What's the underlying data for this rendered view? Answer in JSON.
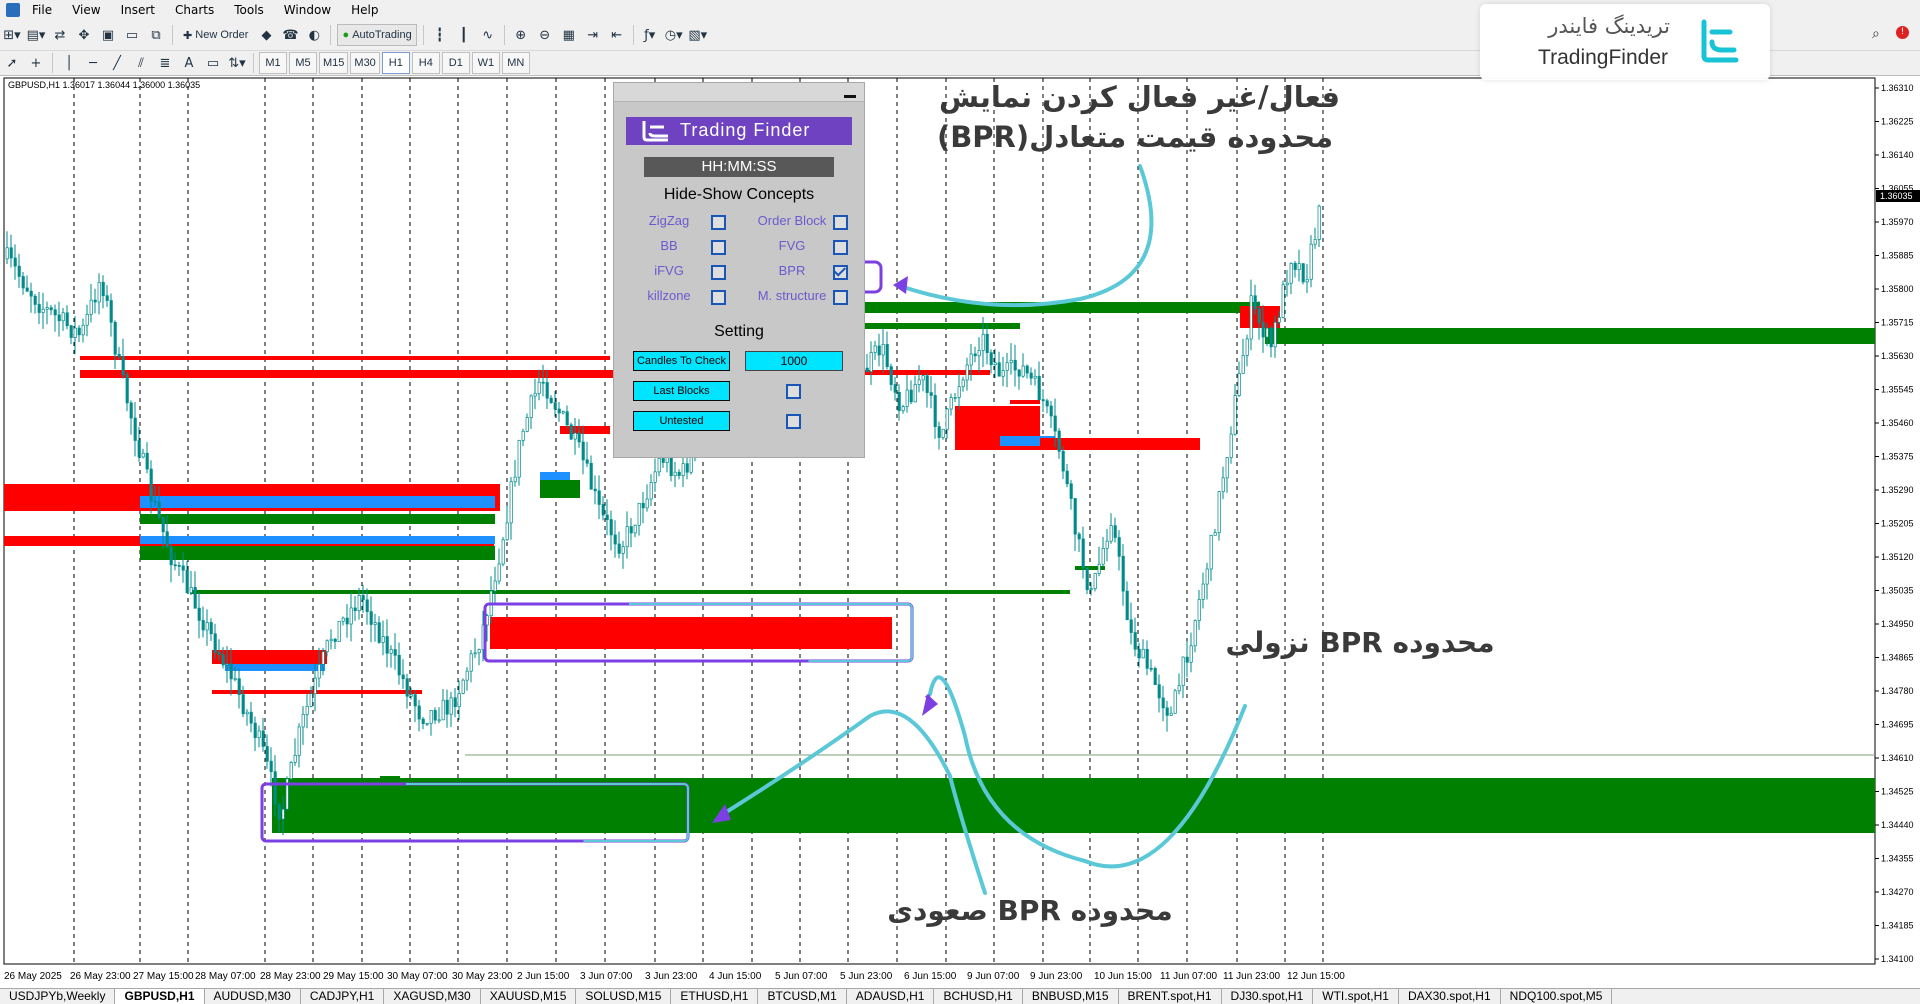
{
  "menu": [
    "File",
    "View",
    "Insert",
    "Charts",
    "Tools",
    "Window",
    "Help"
  ],
  "toolbar": {
    "new_order": "New Order",
    "autotrading": "AutoTrading",
    "timeframes": [
      "M1",
      "M5",
      "M15",
      "M30",
      "H1",
      "H4",
      "D1",
      "W1",
      "MN"
    ],
    "active_timeframe": "H1"
  },
  "logo": {
    "arabic": "تریدینگ فایندر",
    "english": "TradingFinder"
  },
  "chart": {
    "info": "GBPUSD,H1  1.36017 1.36044 1.36000 1.36035",
    "current_price": "1.36035",
    "price_labels": [
      "1.36310",
      "1.36225",
      "1.36140",
      "1.36055",
      "1.35970",
      "1.35885",
      "1.35800",
      "1.35715",
      "1.35630",
      "1.35545",
      "1.35460",
      "1.35375",
      "1.35290",
      "1.35205",
      "1.35120",
      "1.35035",
      "1.34950",
      "1.34865",
      "1.34780",
      "1.34695",
      "1.34610",
      "1.34525",
      "1.34440",
      "1.34355",
      "1.34270",
      "1.34185",
      "1.34100"
    ],
    "time_labels": [
      "26 May 2025",
      "26 May 23:00",
      "27 May 15:00",
      "28 May 07:00",
      "28 May 23:00",
      "29 May 15:00",
      "30 May 07:00",
      "30 May 23:00",
      "2 Jun 15:00",
      "3 Jun 07:00",
      "3 Jun 23:00",
      "4 Jun 15:00",
      "5 Jun 07:00",
      "5 Jun 23:00",
      "6 Jun 15:00",
      "9 Jun 07:00",
      "9 Jun 23:00",
      "10 Jun 15:00",
      "11 Jun 07:00",
      "11 Jun 23:00",
      "12 Jun 15:00"
    ],
    "colors": {
      "bear": "#ff0000",
      "bull": "#008000",
      "blue": "#1e90ff",
      "candle": "#008b8b"
    }
  },
  "panel": {
    "logo_text": "Trading Finder",
    "time": "HH:MM:SS",
    "heading": "Hide-Show Concepts",
    "options": [
      {
        "label": "ZigZag",
        "checked": false
      },
      {
        "label": "Order Block",
        "checked": false
      },
      {
        "label": "BB",
        "checked": false
      },
      {
        "label": "FVG",
        "checked": false
      },
      {
        "label": "iFVG",
        "checked": false
      },
      {
        "label": "BPR",
        "checked": true
      },
      {
        "label": "killzone",
        "checked": false
      },
      {
        "label": "M. structure",
        "checked": false
      }
    ],
    "setting_heading": "Setting",
    "candles_label": "Candles To Check",
    "candles_value": "1000",
    "last_blocks": "Last Blocks",
    "untested": "Untested"
  },
  "annotations": {
    "title_line1": "فعال/غیر فعال کردن نمایش",
    "title_line2": "محدوده قیمت متعادل(BPR)",
    "bearish": "محدوده  BPR نزولی",
    "bullish": "محدوده  BPR صعودی",
    "arrow_color": "#7b3fe4",
    "box_color": "#5bc8d8"
  },
  "tabs": [
    "USDJPYb,Weekly",
    "GBPUSD,H1",
    "AUDUSD,M30",
    "CADJPY,H1",
    "XAGUSD,M30",
    "XAUUSD,M15",
    "SOLUSD,M15",
    "ETHUSD,H1",
    "BTCUSD,M1",
    "ADAUSD,H1",
    "BCHUSD,H1",
    "BNBUSD,M15",
    "BRENT.spot,H1",
    "DJ30.spot,H1",
    "WTI.spot,H1",
    "DAX30.spot,H1",
    "NDQ100.spot,M5"
  ],
  "active_tab": "GBPUSD,H1"
}
